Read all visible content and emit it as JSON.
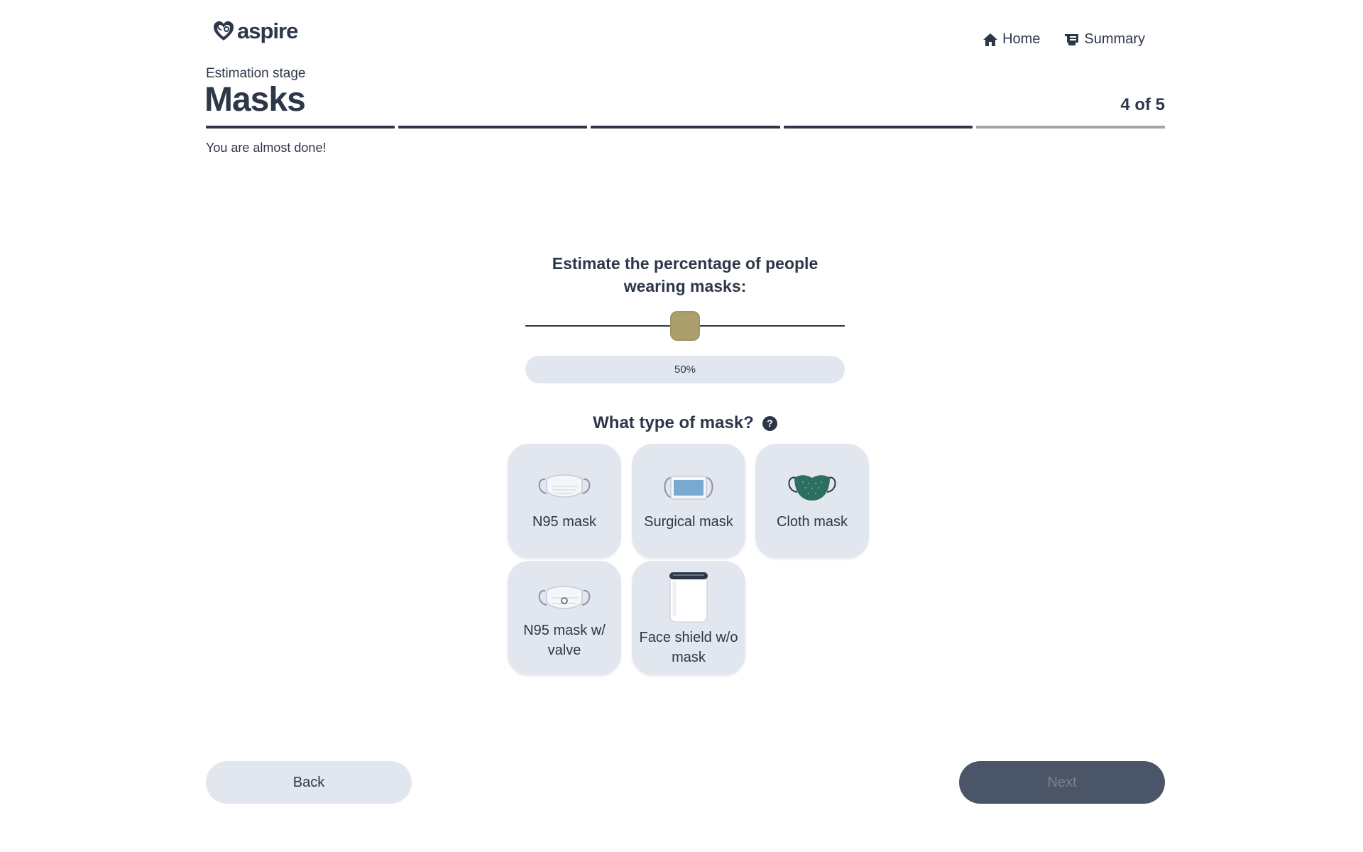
{
  "brand": {
    "name": "aspire",
    "logo_icon": "heart-stethoscope-icon"
  },
  "nav": {
    "home": {
      "label": "Home",
      "icon": "home-icon"
    },
    "summary": {
      "label": "Summary",
      "icon": "summary-icon"
    }
  },
  "header": {
    "stage": "Estimation stage",
    "title": "Masks",
    "step": "4 of 5",
    "subtitle": "You are almost done!"
  },
  "progress": {
    "current": 4,
    "total": 5
  },
  "estimate": {
    "question": "Estimate the percentage of people wearing masks:",
    "value": 50,
    "value_label": "50%",
    "min": 0,
    "max": 100
  },
  "mask_types": {
    "question": "What type of mask?",
    "help": "?",
    "options": [
      {
        "label": "N95 mask",
        "icon": "n95-mask-icon"
      },
      {
        "label": "Surgical mask",
        "icon": "surgical-mask-icon"
      },
      {
        "label": "Cloth mask",
        "icon": "cloth-mask-icon"
      },
      {
        "label": "N95 mask w/ valve",
        "icon": "n95-valve-mask-icon"
      },
      {
        "label": "Face shield w/o mask",
        "icon": "face-shield-icon"
      }
    ]
  },
  "footer": {
    "back": "Back",
    "next": "Next"
  },
  "colors": {
    "primary": "#2d3748",
    "slider_thumb": "#ab9f6c",
    "pill_bg": "#e2e6ee",
    "next_bg": "#4a5568"
  }
}
